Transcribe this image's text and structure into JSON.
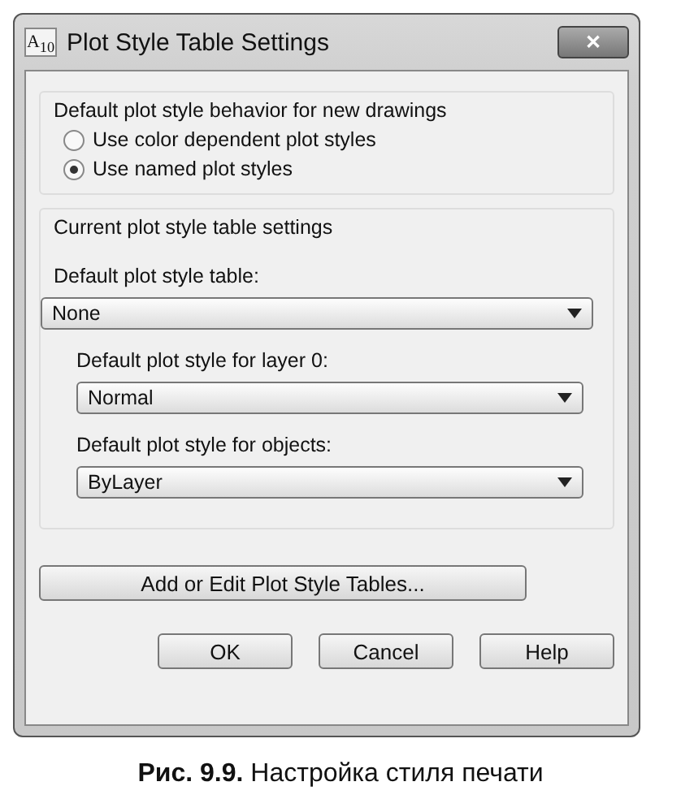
{
  "window": {
    "app_icon": "A$_{10}$",
    "title": "Plot Style Table Settings",
    "close": "✕"
  },
  "behavior_group": {
    "title": "Default plot style behavior for new drawings",
    "options": [
      {
        "label": "Use color dependent plot styles",
        "selected": false
      },
      {
        "label": "Use named plot styles",
        "selected": true
      }
    ]
  },
  "table_group": {
    "title": "Current plot style table settings",
    "fields": [
      {
        "label": "Default plot style table:",
        "value": "None",
        "indented": false
      },
      {
        "label": "Default plot style for layer 0:",
        "value": "Normal",
        "indented": true
      },
      {
        "label": "Default plot style for objects:",
        "value": "ByLayer",
        "indented": true
      }
    ]
  },
  "add_button": "Add or Edit Plot Style Tables...",
  "buttons": [
    "OK",
    "Cancel",
    "Help"
  ],
  "caption": "**Рис. 9.9.** Настройка стиля печати"
}
